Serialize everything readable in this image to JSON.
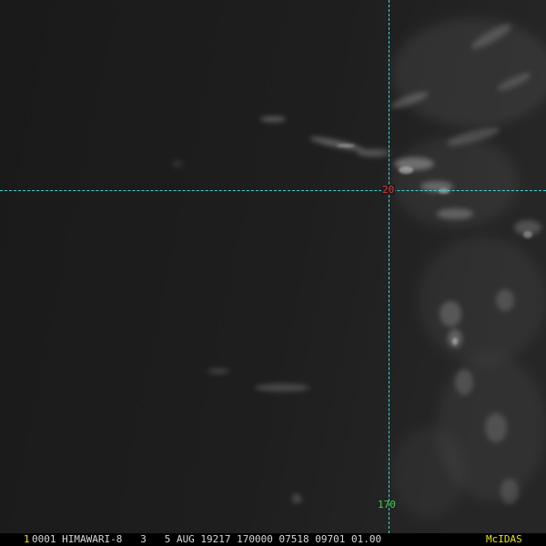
{
  "image": {
    "grid": {
      "latitude_label": "20",
      "longitude_label": "170",
      "line_color": "#3fd6d6",
      "latitude_label_color": "#d43a3a",
      "longitude_label_color": "#39d64a"
    }
  },
  "status_bar": {
    "frame_number": "1",
    "text": "0001 HIMAWARI-8   3   5 AUG 19217 170000 07518 09701 01.00",
    "brand": "McIDAS",
    "frame_color": "#e6e600",
    "brand_color": "#e6e600"
  }
}
